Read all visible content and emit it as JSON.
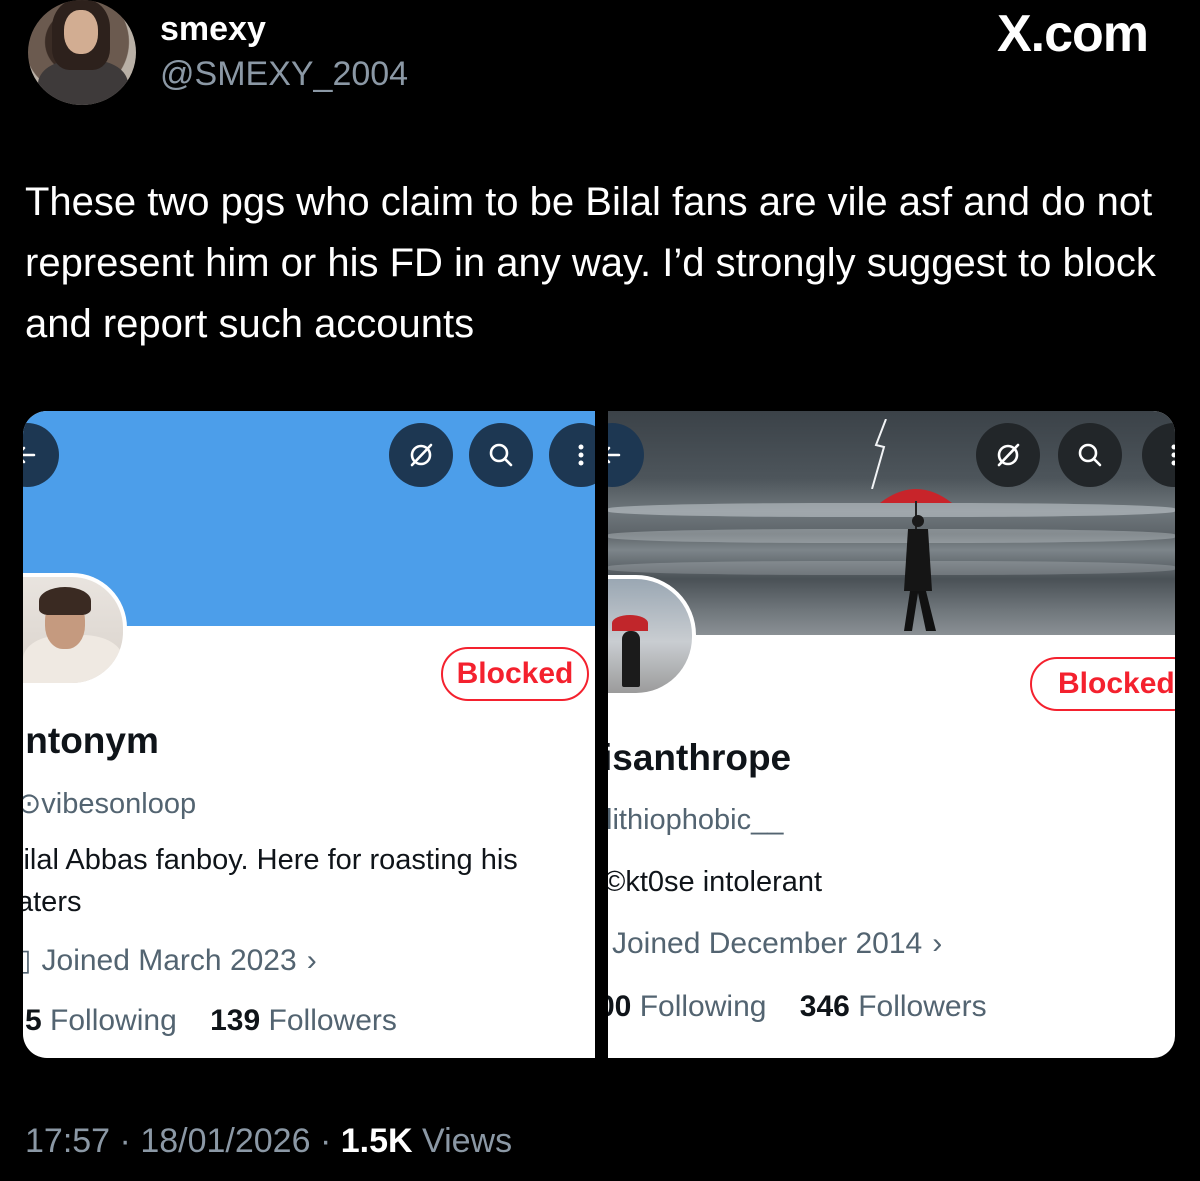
{
  "author": {
    "name": "smexy",
    "handle": "@SMEXY_2004"
  },
  "brand": "X.com",
  "tweet": {
    "text": "These two pgs who claim to be Bilal fans are vile asf and do not represent him or his FD in any way. I’d strongly suggest to block and report such accounts"
  },
  "profiles": [
    {
      "name": "‘ntonym",
      "handle": "⊙vibesonloop",
      "bio": "‘ilal Abbas fanboy. Here for roasting his aters",
      "joined": "Joined March 2023",
      "following_count": "5",
      "following_label": "Following",
      "followers_count": "139",
      "followers_label": "Followers",
      "blocked_label": "Blocked",
      "banner_color": "#4c9eea"
    },
    {
      "name": "isanthrope",
      "handle": "lithiophobic__",
      "bio": "©kt0se intolerant",
      "joined": "Joined December 2014",
      "following_count": "00",
      "following_label": "Following",
      "followers_count": "346",
      "followers_label": "Followers",
      "blocked_label": "Blocked"
    }
  ],
  "footer": {
    "time": "17:57",
    "sep1": "·",
    "date": "18/01/2026",
    "sep2": "·",
    "views_count": "1.5K",
    "views_label": "Views"
  },
  "colors": {
    "background": "#000000",
    "blocked": "#f4212e",
    "secondary_text": "#8b98a5"
  }
}
